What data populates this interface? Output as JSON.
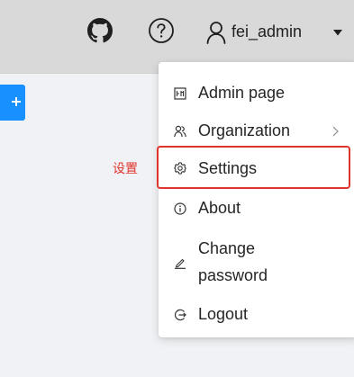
{
  "header": {
    "username": "fei_admin",
    "icons": {
      "github": "github-icon",
      "help": "question-circle-icon",
      "user": "user-icon",
      "caret": "caret-down-icon"
    }
  },
  "menu": {
    "items": [
      {
        "label": "Admin page",
        "icon": "admin-icon"
      },
      {
        "label": "Organization",
        "icon": "organization-icon",
        "has_submenu": true
      },
      {
        "label": "Settings",
        "icon": "gear-icon"
      },
      {
        "label": "About",
        "icon": "info-icon"
      },
      {
        "label": "Change password",
        "icon": "edit-icon"
      },
      {
        "label": "Logout",
        "icon": "logout-icon"
      }
    ]
  },
  "annotation": {
    "label": "设置",
    "color": "#e0332b"
  },
  "colors": {
    "primary_button": "#1890ff",
    "header_bg": "#d9d9d9"
  }
}
